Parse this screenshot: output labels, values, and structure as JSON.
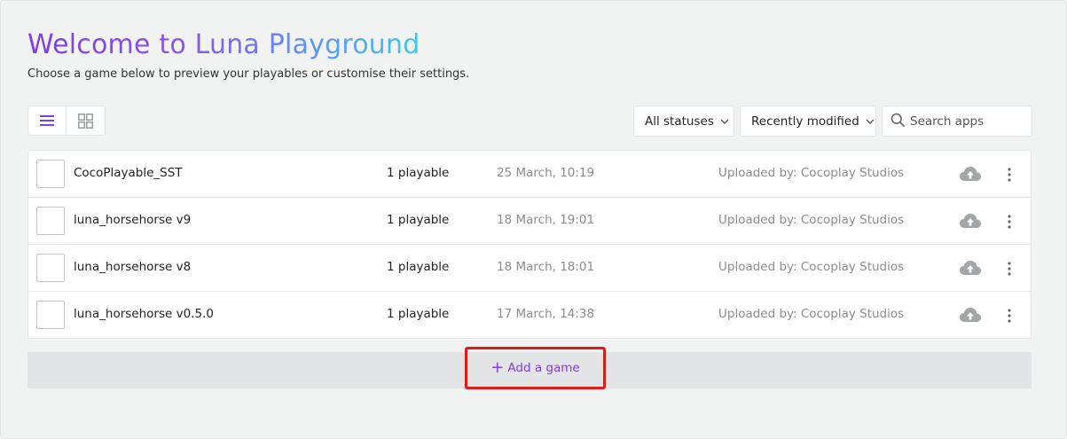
{
  "header": {
    "title": "Welcome to Luna Playground",
    "subtitle": "Choose a game below to preview your playables or customise their settings."
  },
  "toolbar": {
    "view_modes": [
      "list",
      "grid"
    ],
    "active_view": "list",
    "status_filter": "All statuses",
    "sort": "Recently modified",
    "search_placeholder": "Search apps"
  },
  "games": [
    {
      "name": "CocoPlayable_SST",
      "playables": "1 playable",
      "date": "25 March, 10:19",
      "uploaded_by": "Uploaded by: Cocoplay Studios"
    },
    {
      "name": "luna_horsehorse v9",
      "playables": "1 playable",
      "date": "18 March, 19:01",
      "uploaded_by": "Uploaded by: Cocoplay Studios"
    },
    {
      "name": "luna_horsehorse v8",
      "playables": "1 playable",
      "date": "18 March, 18:01",
      "uploaded_by": "Uploaded by: Cocoplay Studios"
    },
    {
      "name": "luna_horsehorse v0.5.0",
      "playables": "1 playable",
      "date": "17 March, 14:38",
      "uploaded_by": "Uploaded by: Cocoplay Studios"
    }
  ],
  "add_game": {
    "label": "Add a game"
  },
  "colors": {
    "accent": "#7b3fe4",
    "title_gradient_end": "#3ec8f0",
    "highlight_box": "#e01a1a",
    "background": "#f1f2f2",
    "muted_text": "#8a8d90"
  },
  "icons": {
    "list_view": "list-icon",
    "grid_view": "grid-icon",
    "dropdown": "chevron-down-icon",
    "search": "search-icon",
    "upload": "cloud-upload-icon",
    "more": "more-vertical-icon",
    "add": "plus-icon"
  }
}
